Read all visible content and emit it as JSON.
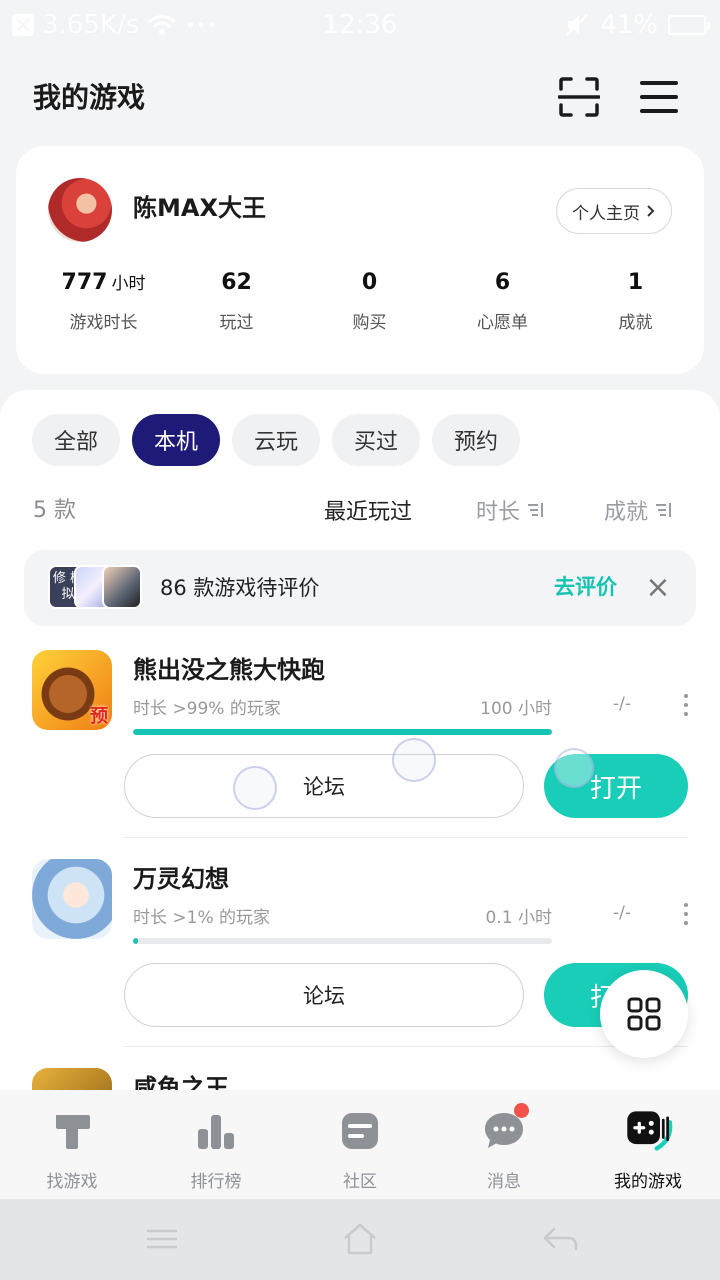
{
  "status_bar": {
    "speed": "3.65K/s",
    "dots": "•••",
    "time": "12:36",
    "battery": "41%"
  },
  "header": {
    "title": "我的游戏"
  },
  "profile": {
    "username": "陈MAX大王",
    "homepage_label": "个人主页",
    "stats": [
      {
        "value": "777",
        "unit": "小时",
        "label": "游戏时长"
      },
      {
        "value": "62",
        "label": "玩过"
      },
      {
        "value": "0",
        "label": "购买"
      },
      {
        "value": "6",
        "label": "心愿单"
      },
      {
        "value": "1",
        "label": "成就"
      }
    ]
  },
  "filters": [
    "全部",
    "本机",
    "云玩",
    "买过",
    "预约"
  ],
  "active_filter": "本机",
  "count_label": "5 款",
  "sort": {
    "recent": "最近玩过",
    "duration": "时长",
    "achievement": "成就"
  },
  "review_banner": {
    "text": "86 款游戏待评价",
    "link": "去评价",
    "close": "×",
    "mini_icon_text": "修 模拟"
  },
  "games": [
    {
      "name": "熊出没之熊大快跑",
      "percentile": "时长 >99% 的玩家",
      "hours": "100 小时",
      "achievement": "-/-",
      "progress": 1.0,
      "forum": "论坛",
      "open": "打开",
      "icon_text": "预"
    },
    {
      "name": "万灵幻想",
      "percentile": "时长 >1% 的玩家",
      "hours": "0.1 小时",
      "achievement": "-/-",
      "progress": 0.01,
      "forum": "论坛",
      "open": "打开"
    },
    {
      "name": "咸鱼之王"
    }
  ],
  "bottom_nav": [
    {
      "label": "找游戏",
      "icon": "find-game-icon"
    },
    {
      "label": "排行榜",
      "icon": "ranking-icon"
    },
    {
      "label": "社区",
      "icon": "community-icon"
    },
    {
      "label": "消息",
      "icon": "message-icon"
    },
    {
      "label": "我的游戏",
      "icon": "my-games-icon",
      "active": true
    }
  ],
  "colors": {
    "accent": "#19cdb8",
    "active_tab": "#1e1a78",
    "badge": "#f2524a"
  }
}
